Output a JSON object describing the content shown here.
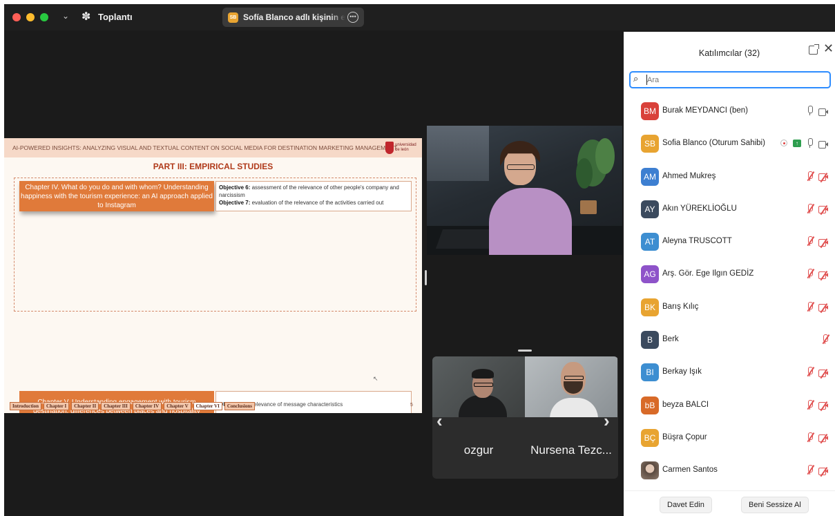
{
  "titlebar": {
    "app_title": "Toplantı",
    "share_badge": "SB",
    "share_text": "Sofía Blanco adlı kişinin ekranı"
  },
  "slide": {
    "header": "AI-POWERED INSIGHTS: ANALYZING VISUAL AND TEXTUAL CONTENT ON SOCIAL MEDIA FOR DESTINATION MARKETING MANAGEMENT",
    "logo_text": "universidad de león",
    "part_title": "PART III: EMPIRICAL STUDIES",
    "chapter4": "Chapter IV. What do you do and with whom? Understanding happiness with the tourism experience: an AI approach applied to Instagram",
    "objective6_label": "Objective 6:",
    "objective6_text": " assessment of the relevance of other people's company and narcissism",
    "objective7_label": "Objective 7:",
    "objective7_text": " evaluation of the relevance of the activities carried out",
    "chapter5": "Chapter V. Understanding engagement with tourism destination, differences between places and hospitality",
    "objective8_label": "Objective 8:",
    "objective8_text": " relevance of message characteristics",
    "nav": [
      "Introduction",
      "Chapter I",
      "Chapter II",
      "Chapter III",
      "Chapter IV",
      "Chapter V",
      "Chapter VI",
      "Conclusions"
    ],
    "page_number": "5"
  },
  "gallery": {
    "tiles": [
      {
        "name": "ozgur"
      },
      {
        "name": "Nursena Tezc..."
      }
    ]
  },
  "panel": {
    "title": "Katılımcılar (32)",
    "search_placeholder": "Ara",
    "participants": [
      {
        "initials": "BM",
        "name": "Burak MEYDANCI (ben)",
        "color": "#d9413a",
        "mic": "on",
        "cam": "on"
      },
      {
        "initials": "SB",
        "name": "Sofia Blanco (Oturum Sahibi)",
        "color": "#e8a431",
        "mic": "on",
        "cam": "on",
        "host": true
      },
      {
        "initials": "AM",
        "name": "Ahmed Mukreş",
        "color": "#3d7fd1",
        "mic": "off",
        "cam": "off"
      },
      {
        "initials": "AY",
        "name": "Akın YÜREKLİOĞLU",
        "color": "#3b4a5e",
        "mic": "off",
        "cam": "off"
      },
      {
        "initials": "AT",
        "name": "Aleyna TRUSCOTT",
        "color": "#3d8ed1",
        "mic": "off",
        "cam": "off"
      },
      {
        "initials": "AG",
        "name": "Arş. Gör. Ege Ilgın GEDİZ",
        "color": "#8e53c9",
        "mic": "off",
        "cam": "off"
      },
      {
        "initials": "BK",
        "name": "Barış Kılıç",
        "color": "#e8a431",
        "mic": "off",
        "cam": "off"
      },
      {
        "initials": "B",
        "name": "Berk",
        "color": "#3b4a5e",
        "mic": "off",
        "cam": "none"
      },
      {
        "initials": "BI",
        "name": "Berkay Işık",
        "color": "#3d8ed1",
        "mic": "off",
        "cam": "off"
      },
      {
        "initials": "bB",
        "name": "beyza BALCI",
        "color": "#d86a28",
        "mic": "off",
        "cam": "off"
      },
      {
        "initials": "BÇ",
        "name": "Büşra Çopur",
        "color": "#e8a431",
        "mic": "off",
        "cam": "off"
      },
      {
        "initials": "",
        "name": "Carmen Santos",
        "color": "photo",
        "mic": "off",
        "cam": "off"
      }
    ],
    "invite_label": "Davet Edin",
    "mute_me_label": "Beni Sessize Al"
  }
}
